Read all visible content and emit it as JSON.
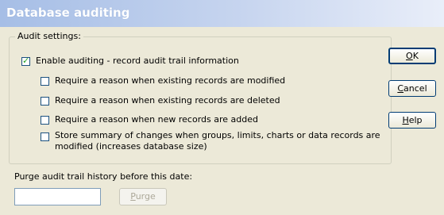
{
  "window": {
    "title": "Database auditing"
  },
  "audit_group": {
    "legend": "Audit settings:",
    "options": [
      {
        "label": "Enable auditing - record audit trail information",
        "checked": true
      },
      {
        "label": "Require a reason when existing records are modified",
        "checked": false
      },
      {
        "label": "Require a reason when existing records are deleted",
        "checked": false
      },
      {
        "label": "Require a reason when new records are added",
        "checked": false
      },
      {
        "label_line1": "Store summary of changes when groups, limits, charts or data records are",
        "label_line2": "modified (increases database size)",
        "checked": false
      }
    ]
  },
  "buttons": {
    "ok": {
      "mnemonic": "O",
      "rest": "K"
    },
    "cancel": {
      "mnemonic": "C",
      "rest": "ancel"
    },
    "help": {
      "mnemonic": "H",
      "rest": "elp"
    }
  },
  "purge": {
    "label": "Purge audit trail history before this date:",
    "date_value": "",
    "button_mnemonic": "P",
    "button_rest": "urge"
  }
}
